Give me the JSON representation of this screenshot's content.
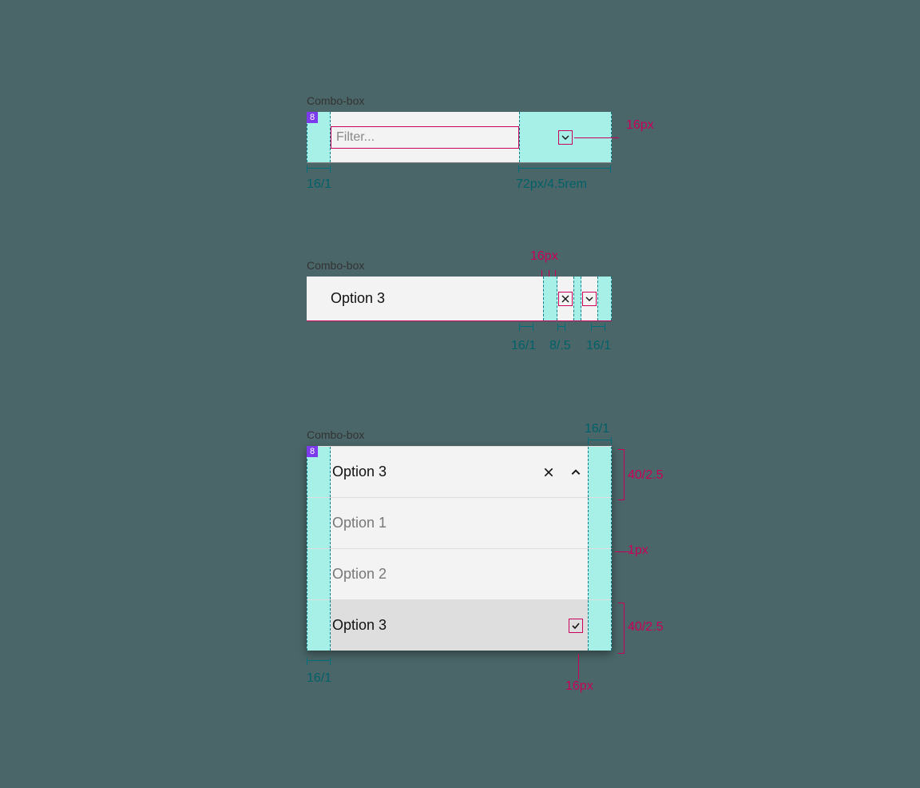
{
  "spec1": {
    "label": "Combo-box",
    "badge": "8",
    "placeholder": "Filter...",
    "measures": {
      "leftCol": "16/1",
      "rightZone": "72px/4.5rem",
      "iconSize": "16px"
    }
  },
  "spec2": {
    "label": "Combo-box",
    "value": "Option 3",
    "measures": {
      "iconSize": "16px",
      "gap1": "16/1",
      "gap2": "8/.5",
      "gap3": "16/1"
    }
  },
  "spec3": {
    "label": "Combo-box",
    "badge": "8",
    "headerValue": "Option 3",
    "options": [
      "Option 1",
      "Option 2",
      "Option 3"
    ],
    "selectedIndex": 2,
    "measures": {
      "topRight": "16/1",
      "rowHeight1": "40/2.5",
      "divider": "1px",
      "rowHeight2": "40/2.5",
      "bottomLeft": "16/1",
      "checkIcon": "16px"
    }
  }
}
